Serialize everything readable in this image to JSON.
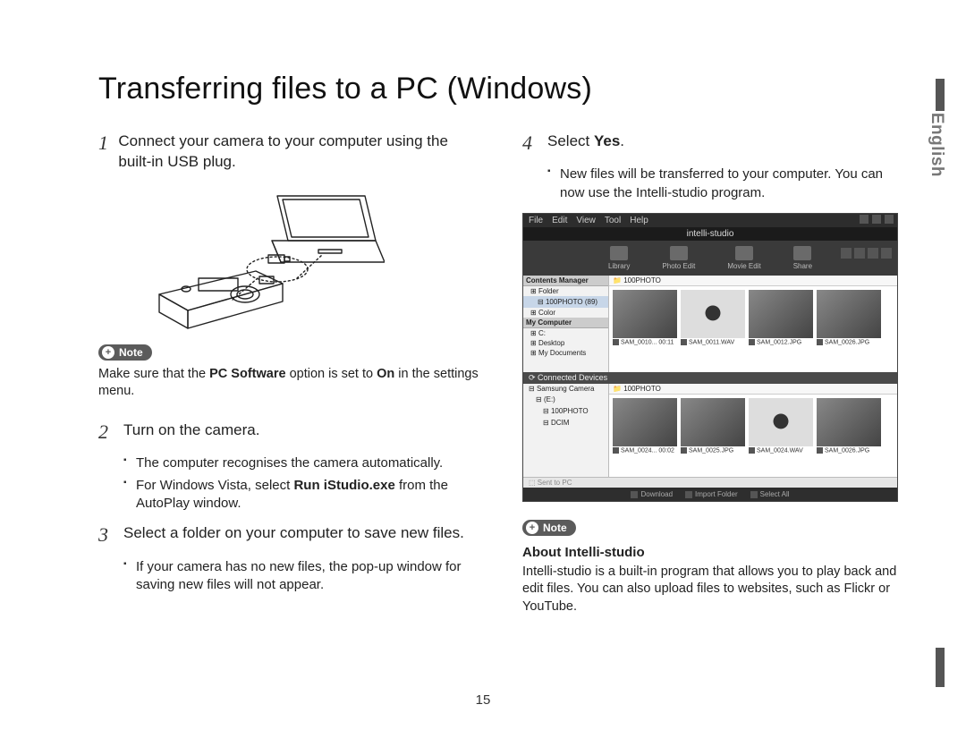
{
  "title": "Transferring files to a PC (Windows)",
  "language_tab": "English",
  "page_number": "15",
  "left": {
    "step1": {
      "num": "1",
      "text_a": "Connect your camera to your computer using the built-in USB plug."
    },
    "note1_label": "Note",
    "note1_a": "Make sure that the ",
    "note1_b": "PC Software",
    "note1_c": " option is set to ",
    "note1_d": "On",
    "note1_e": " in the settings menu.",
    "step2": {
      "num": "2",
      "text": "Turn on the camera."
    },
    "step2_sub1": "The computer recognises the camera automatically.",
    "step2_sub2_a": "For Windows Vista, select ",
    "step2_sub2_b": "Run iStudio.exe",
    "step2_sub2_c": " from the AutoPlay window.",
    "step3": {
      "num": "3",
      "text": "Select a folder on your computer to save new files."
    },
    "step3_sub1": "If your camera has no new files, the pop-up window for saving new files will not appear."
  },
  "right": {
    "step4": {
      "num": "4",
      "text_a": "Select ",
      "text_b": "Yes",
      "text_c": "."
    },
    "step4_sub1": "New files will be transferred to your computer. You can now use the Intelli-studio program.",
    "note2_label": "Note",
    "about_title": "About Intelli-studio",
    "about_text": "Intelli-studio is a built-in program that allows you to play back and edit files. You can also upload files to websites, such as Flickr or YouTube."
  },
  "intelli": {
    "logo": "intelli-studio",
    "menu": [
      "File",
      "Edit",
      "View",
      "Tool",
      "Help"
    ],
    "tools": [
      "Library",
      "Photo Edit",
      "Movie Edit",
      "Share"
    ],
    "cm_header": "Contents Manager",
    "cm_items": [
      "Folder",
      "100PHOTO",
      "Color"
    ],
    "cm_selected_suffix": "(89)",
    "mycomp": "My Computer",
    "mycomp_items": [
      "C:",
      "Desktop",
      "My Documents"
    ],
    "path1": "100PHOTO",
    "thumbs1": [
      "SAM_0010... 00:11",
      "SAM_0011.WAV",
      "SAM_0012.JPG",
      "SAM_0026.JPG"
    ],
    "sep": "Connected Devices",
    "dev_items": [
      "Samsung Camera",
      "(E:)",
      "100PHOTO",
      "DCIM"
    ],
    "path2": "100PHOTO",
    "thumbs2": [
      "SAM_0024... 00:02",
      "SAM_0025.JPG",
      "SAM_0024.WAV",
      "SAM_0026.JPG"
    ],
    "status": [
      "Download",
      "Import Folder",
      "Select All"
    ],
    "foot": "Sent to PC"
  }
}
